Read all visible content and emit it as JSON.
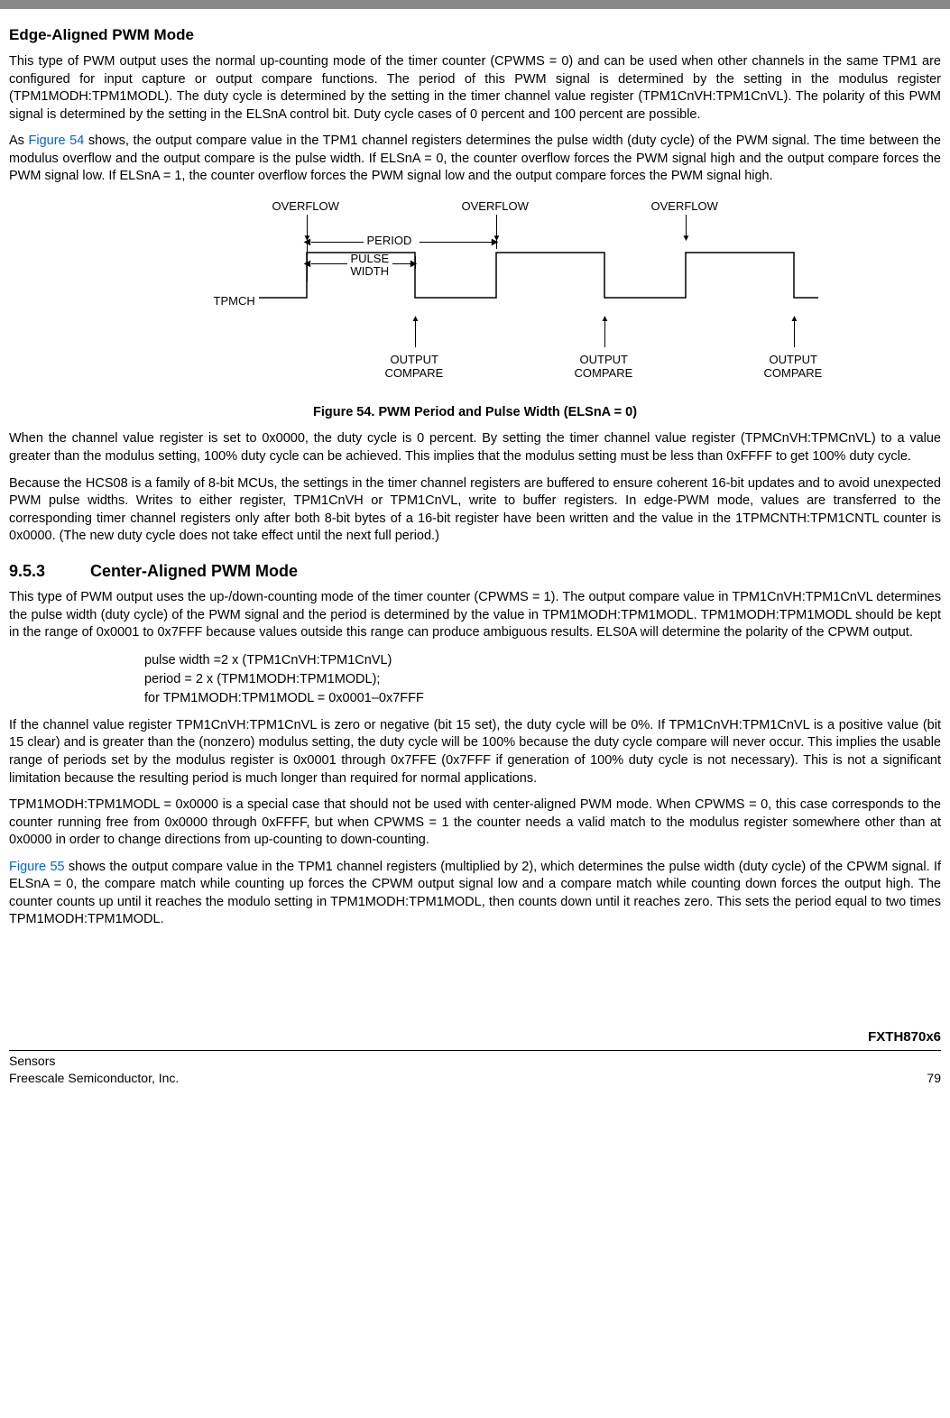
{
  "sections": {
    "edge_title": "Edge-Aligned PWM Mode",
    "edge_p1": "This type of PWM output uses the normal up-counting mode of the timer counter (CPWMS = 0) and can be used when other channels in the same TPM1 are configured for input capture or output compare functions. The period of this PWM signal is determined by the setting in the modulus register (TPM1MODH:TPM1MODL). The duty cycle is determined by the setting in the timer channel value register (TPM1CnVH:TPM1CnVL). The polarity of this PWM signal is determined by the setting in the ELSnA control bit. Duty cycle cases of 0 percent and 100 percent are possible.",
    "edge_p2_pre": "As ",
    "edge_p2_ref": "Figure 54",
    "edge_p2_post": " shows, the output compare value in the TPM1 channel registers determines the pulse width (duty cycle) of the PWM signal. The time between the modulus overflow and the output compare is the pulse width. If ELSnA = 0, the counter overflow forces the PWM signal high and the output compare forces the PWM signal low. If ELSnA = 1, the counter overflow forces the PWM signal low and the output compare forces the PWM signal high.",
    "fig_caption": "Figure 54. PWM Period and Pulse Width (ELSnA = 0)",
    "edge_p3": "When the channel value register is set to 0x0000, the duty cycle is 0 percent. By setting the timer channel value register (TPMCnVH:TPMCnVL) to a value greater than the modulus setting, 100% duty cycle can be achieved. This implies that the modulus setting must be less than 0xFFFF to get 100% duty cycle.",
    "edge_p4": "Because the HCS08 is a family of 8-bit MCUs, the settings in the timer channel registers are buffered to ensure coherent 16-bit updates and to avoid unexpected PWM pulse widths. Writes to either register, TPM1CnVH or TPM1CnVL, write to buffer registers. In edge-PWM mode, values are transferred to the corresponding timer channel registers only after both 8-bit bytes of a 16-bit register have been written and the value in the 1TPMCNTH:TPM1CNTL counter is 0x0000. (The new duty cycle does not take effect until the next full period.)",
    "center_num": "9.5.3",
    "center_title": "Center-Aligned PWM Mode",
    "center_p1": "This type of PWM output uses the up-/down-counting mode of the timer counter (CPWMS = 1). The output compare value in TPM1CnVH:TPM1CnVL determines the pulse width (duty cycle) of the PWM signal and the period is determined by the value in TPM1MODH:TPM1MODL. TPM1MODH:TPM1MODL should be kept in the range of 0x0001 to 0x7FFF because values outside this range can produce ambiguous results. ELS0A will determine the polarity of the CPWM output.",
    "formula_l1": "pulse width =2 x (TPM1CnVH:TPM1CnVL)",
    "formula_l2": "period = 2 x (TPM1MODH:TPM1MODL);",
    "formula_l3": "for TPM1MODH:TPM1MODL = 0x0001–0x7FFF",
    "center_p2": "If the channel value register TPM1CnVH:TPM1CnVL is zero or negative (bit 15 set), the duty cycle will be 0%. If TPM1CnVH:TPM1CnVL is a positive value (bit 15 clear) and is greater than the (nonzero) modulus setting, the duty cycle will be 100% because the duty cycle compare will never occur. This implies the usable range of periods set by the modulus register is 0x0001 through 0x7FFE (0x7FFF if generation of 100% duty cycle is not necessary). This is not a significant limitation because the resulting period is much longer than required for normal applications.",
    "center_p3": "TPM1MODH:TPM1MODL = 0x0000 is a special case that should not be used with center-aligned PWM mode. When CPWMS = 0, this case corresponds to the counter running free from 0x0000 through 0xFFFF, but when CPWMS = 1 the counter needs a valid match to the modulus register somewhere other than at 0x0000 in order to change directions from up-counting to down-counting.",
    "center_p4_ref": "Figure 55",
    "center_p4_post": " shows the output compare value in the TPM1 channel registers (multiplied by 2), which determines the pulse width (duty cycle) of the CPWM signal. If ELSnA = 0, the compare match while counting up forces the CPWM output signal low and a compare match while counting down forces the output high. The counter counts up until it reaches the modulo setting in TPM1MODH:TPM1MODL, then counts down until it reaches zero. This sets the period equal to two times TPM1MODH:TPM1MODL."
  },
  "figure": {
    "overflow": "OVERFLOW",
    "period": "PERIOD",
    "pulse": "PULSE",
    "width": "WIDTH",
    "tpmch": "TPMCH",
    "output": "OUTPUT",
    "compare": "COMPARE"
  },
  "footer": {
    "model": "FXTH870x6",
    "left1": "Sensors",
    "left2": "Freescale Semiconductor, Inc.",
    "pageno": "79"
  }
}
